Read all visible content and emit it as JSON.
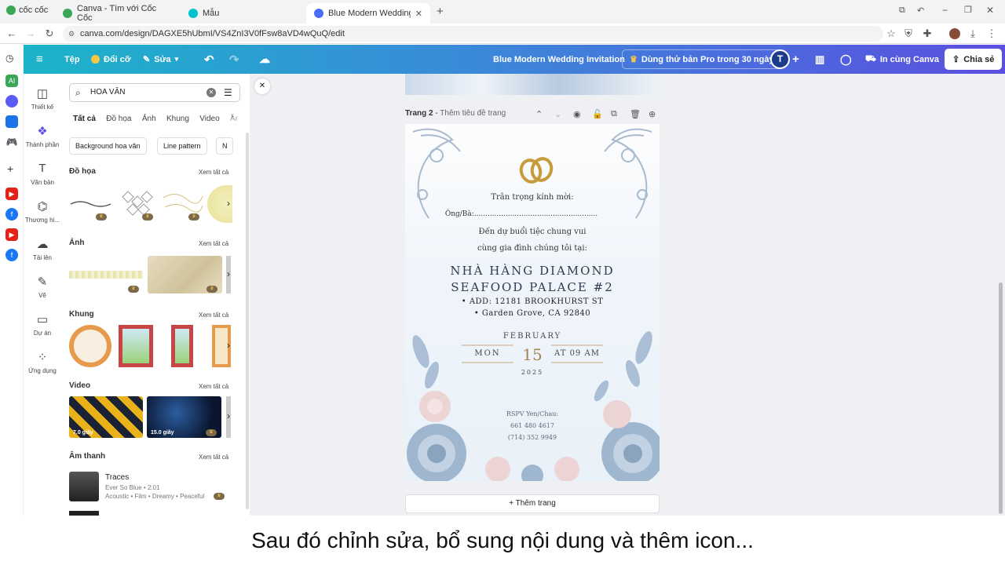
{
  "browser": {
    "logo_text": "cốc cốc",
    "tabs": [
      {
        "label": "Canva - Tìm với Cốc Cốc"
      },
      {
        "label": "Mẫu"
      },
      {
        "label": "Blue Modern Wedding Invitati"
      }
    ],
    "url": "canva.com/design/DAGXE5hUbmI/VS4ZnI3V0fFsw8aVD4wQuQ/edit"
  },
  "header": {
    "menu_file": "Tệp",
    "resize": "Đổi cỡ",
    "edit": "Sửa",
    "doc_title": "Blue Modern Wedding Invitation",
    "pro_trial": "Dùng thử bản Pro trong 30 ngày",
    "avatar_letter": "T",
    "print_label": "In cùng Canva",
    "share_label": "Chia sẻ"
  },
  "sidenav": [
    {
      "label": "Thiết kế",
      "icon": "layout-icon"
    },
    {
      "label": "Thành phần",
      "icon": "elements-icon"
    },
    {
      "label": "Văn bản",
      "icon": "text-icon"
    },
    {
      "label": "Thương hi...",
      "icon": "brand-icon"
    },
    {
      "label": "Tải lên",
      "icon": "upload-icon"
    },
    {
      "label": "Vẽ",
      "icon": "draw-icon"
    },
    {
      "label": "Dự án",
      "icon": "folder-icon"
    },
    {
      "label": "Ứng dụng",
      "icon": "apps-icon"
    }
  ],
  "panel": {
    "search_value": "HOA VĂN",
    "tabs": [
      "Tất cả",
      "Đồ họa",
      "Ảnh",
      "Khung",
      "Video",
      "Âm"
    ],
    "chips": [
      "Background hoa văn",
      "Line pattern",
      "N"
    ],
    "see_all": "Xem tất cả",
    "sections": {
      "graphics": "Đồ họa",
      "photos": "Ảnh",
      "frames": "Khung",
      "video": "Video",
      "audio": "Âm thanh"
    },
    "videos": [
      {
        "duration": "7.0 giây"
      },
      {
        "duration": "15.0 giây"
      }
    ],
    "audio_item": {
      "title": "Traces",
      "artist": "Ever So Blue • 2:01",
      "tags": "Acoustic • Film • Dreamy • Peaceful"
    }
  },
  "page": {
    "label": "Trang 2",
    "title_placeholder": "Thêm tiêu đề trang",
    "add_page": "+ Thêm trang"
  },
  "invitation": {
    "line1": "Trân trọng kính mời:",
    "line2": "Ông/Bà:.......................................................",
    "line3": "Đến dự buổi tiệc chung vui",
    "line4": "cùng gia đình chúng tôi tại:",
    "venue1": "NHÀ HÀNG DIAMOND",
    "venue2": "SEAFOOD PALACE #2",
    "addr1": "ADD: 12181 BROOKHURST ST",
    "addr2": "Garden Grove, CA 92840",
    "month": "FEBRUARY",
    "weekday": "MON",
    "day": "15",
    "time": "AT 09 AM",
    "year": "2025",
    "rsvp": "RSPV Yen/Chau:",
    "phone1": "661 480 4617",
    "phone2": "(714) 352 9949"
  },
  "caption": "Sau đó chỉnh sửa, bổ sung nội dung và thêm icon..."
}
